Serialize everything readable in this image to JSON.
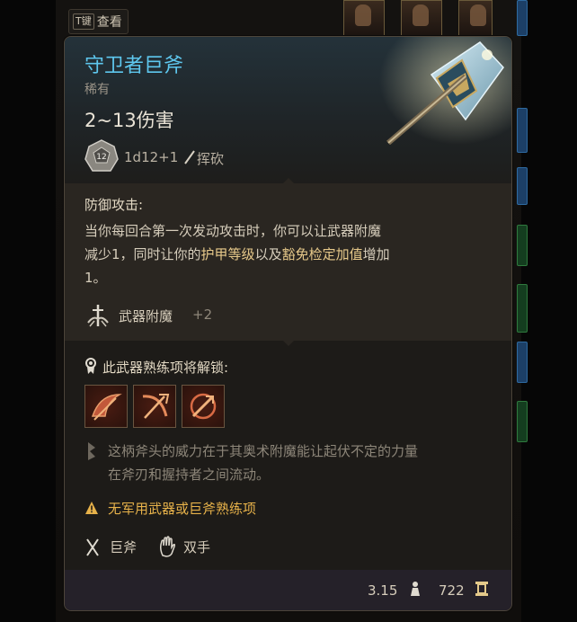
{
  "hint": {
    "key": "T键",
    "label": "查看"
  },
  "item": {
    "name": "守卫者巨斧",
    "rarity": "稀有",
    "damage": "2~13伤害",
    "dice_face": "12",
    "damage_dice": "1d12+1",
    "damage_type": "挥砍",
    "image_icon": "greataxe-icon"
  },
  "passive": {
    "title": "防御攻击:",
    "lines": [
      "当你每回合第一次发动攻击时，你可以让武器附魔",
      "减少1，同时让你的",
      "护甲等级",
      "以及",
      "豁免检定加值",
      "增加",
      "1。"
    ]
  },
  "enchantment": {
    "label": "武器附魔",
    "bonus": "+2"
  },
  "proficiency": {
    "label": "此武器熟练项将解锁:",
    "actions": [
      "cleave-icon",
      "lacerate-icon",
      "rush-attack-icon"
    ]
  },
  "lore": {
    "line1": "这柄斧头的威力在于其奥术附魔能让起伏不定的力量",
    "line2": "在斧刃和握持者之间流动。"
  },
  "warning": "无军用武器或巨斧熟练项",
  "tags": {
    "weapon_type": "巨斧",
    "handedness": "双手"
  },
  "footer": {
    "weight": "3.15",
    "price": "722"
  },
  "colors": {
    "name": "#5ec7ee",
    "warning": "#e7b24a",
    "highlight": "#e7c98a"
  }
}
